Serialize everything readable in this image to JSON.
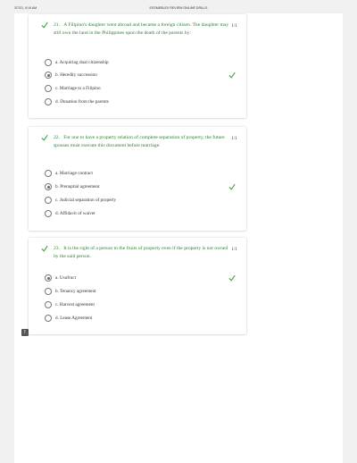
{
  "header": {
    "datetime": "3/7/21, 9:19 AM",
    "title": "ESSMEBLEX REVIEW ONLINE DRILLS"
  },
  "questions": [
    {
      "number": "21.",
      "text": "A Filipino's daughter went abroad and became a foreign citizen. The daughter may still own the land in the Philippines upon the death of the parents by:",
      "points": "1/1",
      "options": [
        "a. Acquiring dual citizenship",
        "b. Heredity succession",
        "c. Marriage to a Filipino",
        "d. Donation from the parents"
      ],
      "selected_index": 1,
      "correct_index": 1
    },
    {
      "number": "22.",
      "text": "For one to have a property relation of complete separation of property, the future spouses must execute this document before marriage:",
      "points": "1/1",
      "options": [
        "a. Marriage contract",
        "b. Prenuptial agreement",
        "c. Judicial separation of property",
        "d. Affidavit of waiver"
      ],
      "selected_index": 1,
      "correct_index": 1
    },
    {
      "number": "23.",
      "text": "It is the right of a person to the fruits of property even if the property is not owned by the said person.",
      "points": "1/1",
      "options": [
        "a. Usufruct",
        "b. Tenancy agreement",
        "c. Harvest agreement",
        "d. Lease Agreement"
      ],
      "selected_index": 0,
      "correct_index": 0
    }
  ],
  "feedback_icon": "exclamation-icon",
  "colors": {
    "correct": "#2e7d32",
    "check": "#43a047",
    "radio_border": "#777777"
  }
}
